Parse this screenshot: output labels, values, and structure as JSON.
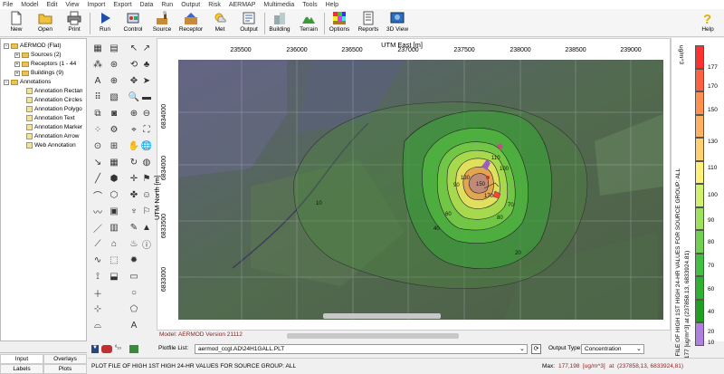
{
  "menu": [
    "File",
    "Model",
    "Edit",
    "View",
    "Import",
    "Export",
    "Data",
    "Run",
    "Output",
    "Risk",
    "AERMAP",
    "Multimedia",
    "Tools",
    "Help"
  ],
  "toolbar": [
    {
      "label": "New",
      "icon": "new-file-icon"
    },
    {
      "label": "Open",
      "icon": "open-folder-icon"
    },
    {
      "label": "Print",
      "icon": "printer-icon"
    },
    {
      "label": "Run",
      "icon": "run-icon"
    },
    {
      "label": "Control",
      "icon": "control-icon"
    },
    {
      "label": "Source",
      "icon": "source-icon"
    },
    {
      "label": "Receptor",
      "icon": "receptor-icon"
    },
    {
      "label": "Met",
      "icon": "met-icon"
    },
    {
      "label": "Output",
      "icon": "output-icon"
    },
    {
      "label": "Building",
      "icon": "building-icon"
    },
    {
      "label": "Terrain",
      "icon": "terrain-icon"
    },
    {
      "label": "Options",
      "icon": "options-icon"
    },
    {
      "label": "Reports",
      "icon": "reports-icon"
    },
    {
      "label": "3D View",
      "icon": "3d-view-icon"
    },
    {
      "label": "Help",
      "icon": "help-icon"
    }
  ],
  "tree": {
    "root": "AERMOD (Flat)",
    "children": [
      "Sources (2)",
      "Receptors (1 - 44",
      "Buildings (9)"
    ],
    "annotations_label": "Annotations",
    "annotations": [
      "Annotation Rectan",
      "Annotation Circles",
      "Annotation Polygo",
      "Annotation Text",
      "Annotation Marker",
      "Annotation Arrow",
      "Web Annotation"
    ]
  },
  "tabs": {
    "input": "Input",
    "overlays": "Overlays",
    "labels": "Labels",
    "plots": "Plots"
  },
  "plot": {
    "x_axis_title": "UTM East [m]",
    "y_axis_title": "UTM North [m]",
    "x_ticks": [
      "235500",
      "236000",
      "236500",
      "237000",
      "237500",
      "238000",
      "238500",
      "239000"
    ],
    "y_ticks": [
      "6834000",
      "6834000",
      "6833500",
      "6833000"
    ],
    "model_version": "Model: AERMOD Version 21112",
    "contour_labels": [
      "10",
      "20",
      "40",
      "60",
      "70",
      "80",
      "90",
      "100",
      "110",
      "130",
      "150",
      "170"
    ]
  },
  "legend": {
    "unit": "ug/m^3",
    "values": [
      "177",
      "170",
      "150",
      "130",
      "110",
      "100",
      "90",
      "80",
      "70",
      "60",
      "40",
      "20",
      "10"
    ],
    "colors": [
      "#ff3030",
      "#ff6040",
      "#ff9050",
      "#ffb060",
      "#ffd070",
      "#fff07a",
      "#d0f070",
      "#a0e060",
      "#70d050",
      "#40c040",
      "#30b030",
      "#20a020",
      "#b080e0"
    ],
    "title_text": "PLOT FILE OF HIGH 1ST HIGH 24-HR VALUES FOR SOURCE GROUP: ALL",
    "max_text": "Max: 177 [ug/m^3] at (237858.13, 6833924.81)"
  },
  "plotfile": {
    "label": "Plotfile List:",
    "value": "aermod_ccgl.AD\\24H1GALL.PLT",
    "output_type_label": "Output Type:",
    "output_type_value": "Concentration"
  },
  "status": {
    "left": "PLOT FILE OF HIGH 1ST HIGH 24-HR VALUES FOR SOURCE GROUP: ALL",
    "max_label": "Max:",
    "max_value": "177,198",
    "max_unit": "[ug/m^3]",
    "at_label": "at",
    "at_value": "(237858,13, 6833924,81)"
  }
}
